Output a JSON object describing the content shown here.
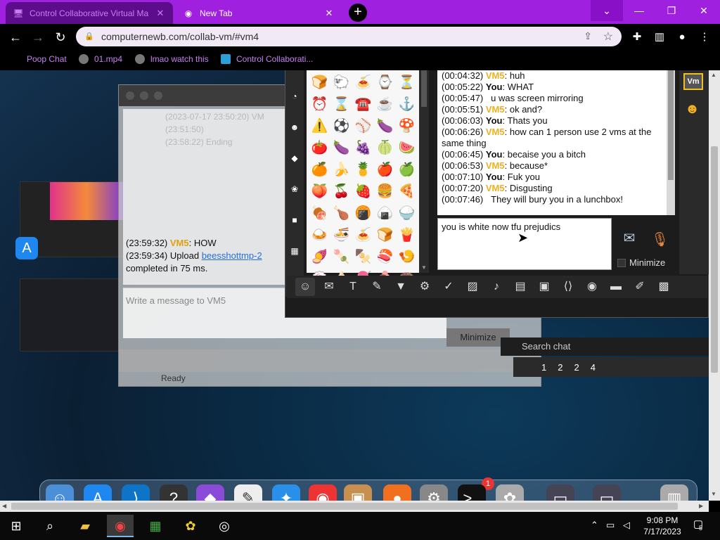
{
  "browser": {
    "tabs": [
      {
        "title": "Control Collaborative Virtual Ma",
        "active": true
      },
      {
        "title": "New Tab",
        "active": false
      }
    ],
    "url": "computernewb.com/collab-vm/#vm4",
    "bookmarks": [
      "Poop Chat",
      "01.mp4",
      "lmao watch this",
      "Control Collaborati..."
    ]
  },
  "back_window": {
    "ghost_lines": [
      "(2023-07-17 23:50:20) VM",
      "(23:51:50)",
      "(23:58:22) Ending"
    ],
    "msg1_time": "(23:59:32)",
    "msg1_user": "VM5",
    "msg1_text": ": HOW",
    "msg2_time": "(23:59:34)",
    "msg2_prefix": " Upload ",
    "msg2_link": "beesshottmp-2",
    "msg2_suffix": "completed in 75 ms.",
    "placeholder": "Write a message to VM5",
    "minimize": "Minimize",
    "status": "Ready"
  },
  "strip": {
    "search": "Search chat",
    "counts": [
      "1",
      "2",
      "2",
      "4"
    ]
  },
  "emoji_grid": [
    "🍞",
    "🐑",
    "🍝",
    "⌚",
    "⏳",
    "⏰",
    "⌛",
    "☎️",
    "☕",
    "⚓",
    "⚠️",
    "⚽",
    "⚾",
    "🍆",
    "🍄",
    "🍅",
    "🍆",
    "🍇",
    "🍈",
    "🍉",
    "🍊",
    "🍌",
    "🍍",
    "🍎",
    "🍏",
    "🍑",
    "🍒",
    "🍓",
    "🍔",
    "🍕",
    "🍖",
    "🍗",
    "🍘",
    "🍙",
    "🍚",
    "🍛",
    "🍜",
    "🍝",
    "🍞",
    "🍟",
    "🍠",
    "🍡",
    "🍢",
    "🍣",
    "🍤",
    "🍥",
    "🍦",
    "🍧",
    "🍨",
    "🍩"
  ],
  "chat_log": [
    {
      "ts": "(00:04:32)",
      "user": "VM5",
      "kind": "vm",
      "text": ": huh"
    },
    {
      "ts": "(00:05:22)",
      "user": "You",
      "kind": "you",
      "text": ": WHAT"
    },
    {
      "ts": "(00:05:47)",
      "user": "",
      "kind": "plain",
      "text": "u was screen mirroring"
    },
    {
      "ts": "(00:05:51)",
      "user": "VM5",
      "kind": "vm",
      "text": ": ok and?"
    },
    {
      "ts": "(00:06:03)",
      "user": "You",
      "kind": "you",
      "text": ": Thats you"
    },
    {
      "ts": "(00:06:26)",
      "user": "VM5",
      "kind": "vm",
      "text": ": how can 1 person use 2 vms at the same thing"
    },
    {
      "ts": "(00:06:45)",
      "user": "You",
      "kind": "you",
      "text": ": becaise you a bitch"
    },
    {
      "ts": "(00:06:53)",
      "user": "VM5",
      "kind": "vm",
      "text": ": because*"
    },
    {
      "ts": "(00:07:10)",
      "user": "You",
      "kind": "you",
      "text": ": Fuk you"
    },
    {
      "ts": "(00:07:20)",
      "user": "VM5",
      "kind": "vm",
      "text": ": Disgusting"
    },
    {
      "ts": "(00:07:46)",
      "user": "",
      "kind": "plain",
      "text": "They will bury you in a lunchbox!"
    }
  ],
  "chat_input": "you is white now tfu prejudics",
  "minimize_label": "Minimize",
  "vm_badge": "Vm",
  "taskbar": {
    "time": "9:08 PM",
    "date": "7/17/2023",
    "notif_count": "5"
  },
  "dock_badge": "1",
  "colors": {
    "tabbar": "#a020e0",
    "vm_name": "#f0b020",
    "bookmark_text": "#c77ff0"
  }
}
